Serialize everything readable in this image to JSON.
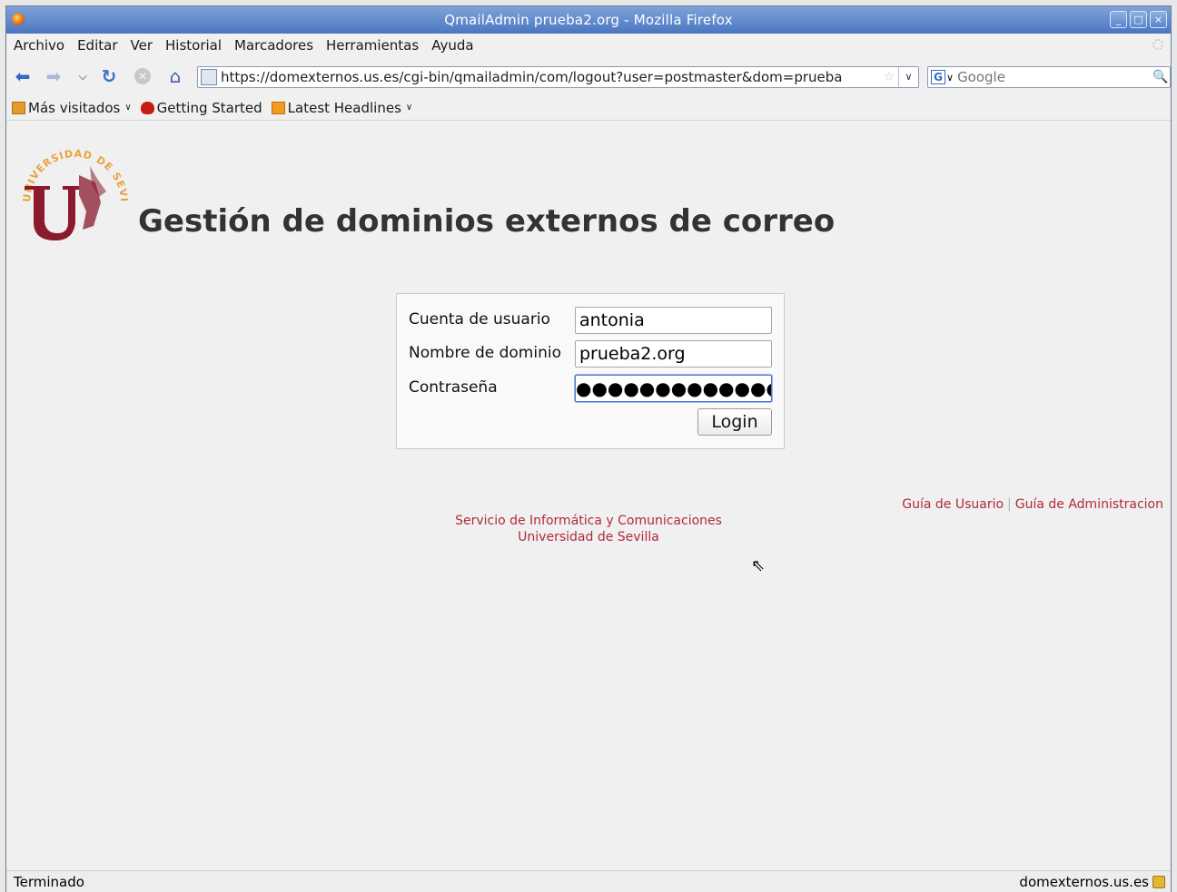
{
  "window": {
    "title": "QmailAdmin prueba2.org - Mozilla Firefox",
    "controls": [
      "_",
      "□",
      "×"
    ]
  },
  "menu": [
    "Archivo",
    "Editar",
    "Ver",
    "Historial",
    "Marcadores",
    "Herramientas",
    "Ayuda"
  ],
  "nav": {
    "url": "https://domexternos.us.es/cgi-bin/qmailadmin/com/logout?user=postmaster&dom=prueba",
    "search_placeholder": "Google"
  },
  "bookmarks": [
    {
      "label": "Más visitados",
      "icon": "folder-icon"
    },
    {
      "label": "Getting Started",
      "icon": "firefox-icon"
    },
    {
      "label": "Latest Headlines",
      "icon": "rss-icon"
    }
  ],
  "page": {
    "logo_text": "UNIVERSIDAD DE SEVILLA",
    "title": "Gestión de dominios externos de correo",
    "form": {
      "user_label": "Cuenta de usuario",
      "user_value": "antonia",
      "domain_label": "Nombre de dominio",
      "domain_value": "prueba2.org",
      "password_label": "Contraseña",
      "password_mask": "●●●●●●●●●●●●●●",
      "login_label": "Login"
    },
    "guides": {
      "user_guide": "Guía de Usuario",
      "separator": "|",
      "admin_guide": "Guía de Administracion"
    },
    "footer": {
      "line1": "Servicio de Informática y Comunicaciones",
      "line2": "Universidad de Sevilla"
    }
  },
  "status": {
    "left": "Terminado",
    "right": "domexternos.us.es"
  },
  "colors": {
    "title_bar": "#4a76c2",
    "link": "#b02a3a",
    "logo_red": "#8b1a2e",
    "logo_gold": "#e8a33a"
  }
}
